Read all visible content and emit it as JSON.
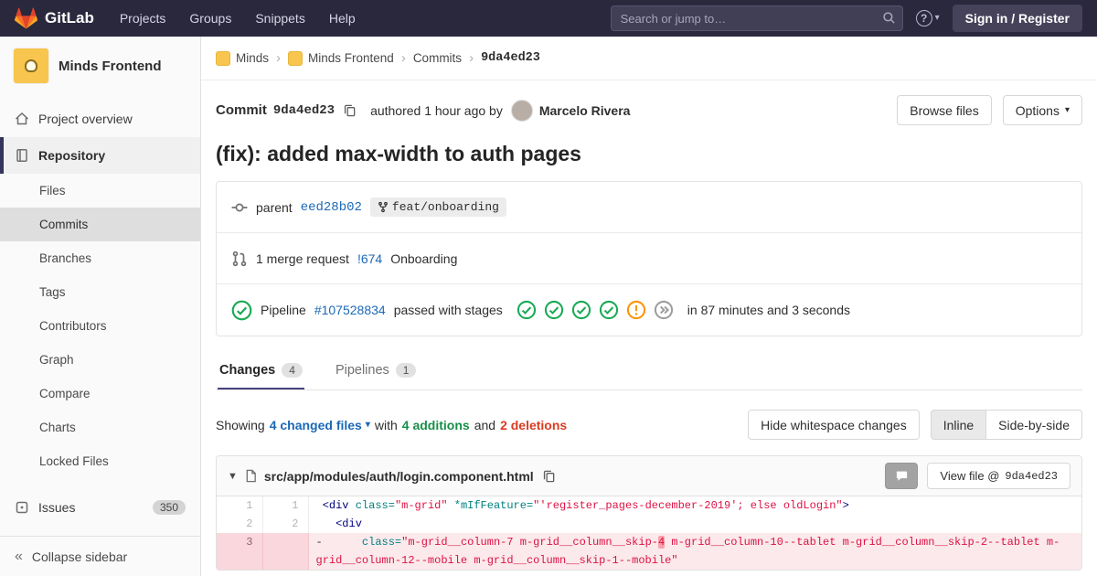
{
  "navbar": {
    "brand": "GitLab",
    "menu": {
      "projects": "Projects",
      "groups": "Groups",
      "snippets": "Snippets",
      "help": "Help"
    },
    "search_placeholder": "Search or jump to…",
    "help_glyph": "?",
    "sign_in_label": "Sign in / Register"
  },
  "sidebar": {
    "project_name": "Minds Frontend",
    "project_overview": "Project overview",
    "repository": "Repository",
    "repo_items": [
      "Files",
      "Commits",
      "Branches",
      "Tags",
      "Contributors",
      "Graph",
      "Compare",
      "Charts",
      "Locked Files"
    ],
    "issues": "Issues",
    "issues_count": "350",
    "collapse_label": "Collapse sidebar"
  },
  "breadcrumb": {
    "items": [
      "Minds",
      "Minds Frontend",
      "Commits",
      "9da4ed23"
    ]
  },
  "commit": {
    "label": "Commit",
    "sha": "9da4ed23",
    "authored": "authored 1 hour ago by",
    "author": "Marcelo Rivera",
    "browse_files_label": "Browse files",
    "options_label": "Options",
    "title": "(fix): added max-width to auth pages"
  },
  "details": {
    "parent_label": "parent",
    "parent_sha": "eed28b02",
    "branch": "feat/onboarding",
    "mr_count_text": "1 merge request",
    "mr_link": "!674",
    "mr_title": "Onboarding",
    "pipeline_label": "Pipeline",
    "pipeline_id": "#107528834",
    "pipeline_status_text": "passed with stages",
    "pipeline_duration": "in 87 minutes and 3 seconds"
  },
  "tabs": {
    "changes_label": "Changes",
    "changes_count": "4",
    "pipelines_label": "Pipelines",
    "pipelines_count": "1"
  },
  "diff_meta": {
    "showing": "Showing",
    "changed_files": "4 changed files",
    "with_text": "with",
    "additions": "4 additions",
    "and_text": "and",
    "deletions": "2 deletions",
    "hide_whitespace_label": "Hide whitespace changes",
    "inline_label": "Inline",
    "side_by_side_label": "Side-by-side"
  },
  "file": {
    "path": "src/app/modules/auth/login.component.html",
    "view_file_label": "View file @",
    "view_file_sha": "9da4ed23"
  },
  "diff": {
    "line1": {
      "old": "1",
      "new": "1",
      "sign": " ",
      "tag_open": "<div ",
      "attr1": "class=",
      "str1": "\"m-grid\"",
      "attr2": " *mIfFeature=",
      "str2": "\"'register_pages-december-2019'; else oldLogin\"",
      "tag_close": ">"
    },
    "line2": {
      "old": "2",
      "new": "2",
      "sign": " ",
      "code": "  <div"
    },
    "line3": {
      "old": "3",
      "new": "",
      "sign": "-",
      "indent": "      ",
      "attr": "class=",
      "str_a": "\"m-grid__column-7 m-grid__column__skip-",
      "mark": "4",
      "str_b": " m-grid__column-10--tablet m-grid__column__skip-2--tablet m-grid__column-12--mobile m-grid__column__skip-1--mobile\""
    }
  },
  "colors": {
    "navbar_bg": "#29283d",
    "brand_orange": "#e24329",
    "success_green": "#1aaa55",
    "warning_orange": "#fc9403",
    "danger_red": "#db3b21",
    "link_blue": "#1b69b6",
    "deletion_bg": "#fbe9eb"
  }
}
